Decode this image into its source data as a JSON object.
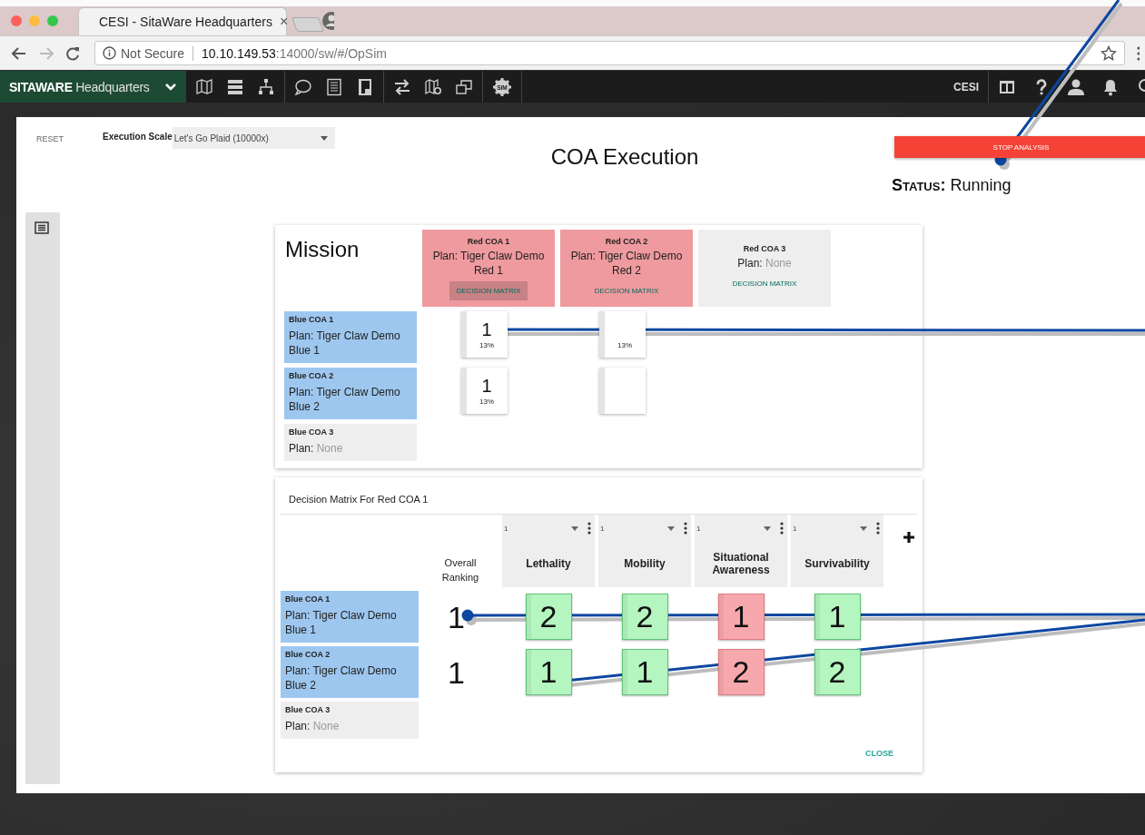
{
  "browser": {
    "tab_title": "CESI - SitaWare Headquarters",
    "tab_close": "×",
    "security": "Not Secure",
    "url_host": "10.10.149.53",
    "url_path": ":14000/sw/#/OpSim"
  },
  "app_bar": {
    "brand_bold": "SITAWARE",
    "brand_light": "Headquarters",
    "sim_label": "SIM",
    "org": "CESI"
  },
  "header": {
    "reset": "RESET",
    "scale_label": "Execution Scale",
    "scale_value": "Let's Go Plaid (10000x)",
    "title": "COA Execution",
    "stop_button": "STOP ANALYSIS",
    "status_label": "Status:",
    "status_value": "Running"
  },
  "mission": {
    "title": "Mission",
    "red_coas": [
      {
        "name": "Red COA 1",
        "plan_label": "Plan:",
        "plan": "Tiger Claw Demo Red 1",
        "has_plan": true,
        "link": "DECISION MATRIX",
        "selected": true
      },
      {
        "name": "Red COA 2",
        "plan_label": "Plan:",
        "plan": "Tiger Claw Demo Red 2",
        "has_plan": true,
        "link": "DECISION MATRIX",
        "selected": false
      },
      {
        "name": "Red COA 3",
        "plan_label": "Plan:",
        "plan": "None",
        "has_plan": false,
        "link": "DECISION MATRIX",
        "selected": false
      }
    ],
    "blue_coas": [
      {
        "name": "Blue COA 1",
        "plan_label": "Plan:",
        "plan": "Tiger Claw Demo Blue 1",
        "has_plan": true
      },
      {
        "name": "Blue COA 2",
        "plan_label": "Plan:",
        "plan": "Tiger Claw Demo Blue 2",
        "has_plan": true
      },
      {
        "name": "Blue COA 3",
        "plan_label": "Plan:",
        "plan": "None",
        "has_plan": false
      }
    ],
    "results": [
      [
        {
          "kind": "result",
          "rank": "1",
          "percent": "13%"
        },
        {
          "kind": "percent",
          "percent": "13%"
        }
      ],
      [
        {
          "kind": "result",
          "rank": "1",
          "percent": "13%"
        },
        {
          "kind": "empty"
        }
      ]
    ]
  },
  "matrix": {
    "title": "Decision Matrix For Red COA 1",
    "overall_label": "Overall Ranking",
    "criteria": [
      {
        "weight": "1",
        "name": "Lethality"
      },
      {
        "weight": "1",
        "name": "Mobility"
      },
      {
        "weight": "1",
        "name": "Situational Awareness"
      },
      {
        "weight": "1",
        "name": "Survivability"
      }
    ],
    "blue_coas": [
      {
        "name": "Blue COA 1",
        "plan_label": "Plan:",
        "plan": "Tiger Claw Demo Blue 1",
        "has_plan": true
      },
      {
        "name": "Blue COA 2",
        "plan_label": "Plan:",
        "plan": "Tiger Claw Demo Blue 2",
        "has_plan": true
      },
      {
        "name": "Blue COA 3",
        "plan_label": "Plan:",
        "plan": "None",
        "has_plan": false
      }
    ],
    "rows": [
      {
        "overall": "1",
        "scores": [
          {
            "value": "2",
            "favorable": true
          },
          {
            "value": "2",
            "favorable": true
          },
          {
            "value": "1",
            "favorable": false
          },
          {
            "value": "1",
            "favorable": true
          }
        ]
      },
      {
        "overall": "1",
        "scores": [
          {
            "value": "1",
            "favorable": true
          },
          {
            "value": "1",
            "favorable": true
          },
          {
            "value": "2",
            "favorable": false
          },
          {
            "value": "2",
            "favorable": true
          }
        ]
      }
    ],
    "close": "CLOSE"
  }
}
